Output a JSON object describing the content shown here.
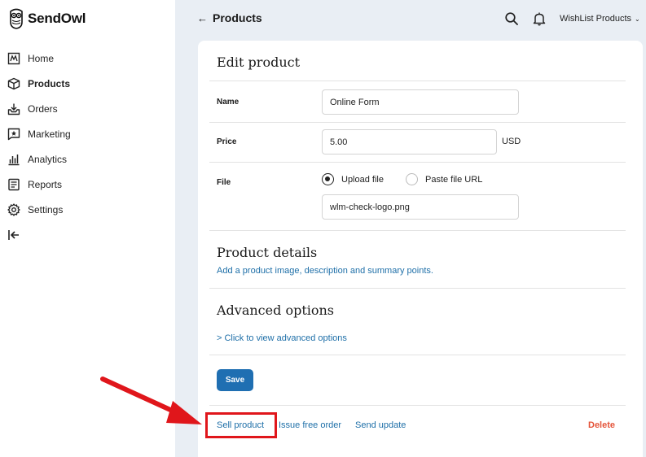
{
  "brand": {
    "name": "SendOwl"
  },
  "sidebar": {
    "items": [
      {
        "label": "Home",
        "icon": "home-chart-icon",
        "active": false
      },
      {
        "label": "Products",
        "icon": "box-icon",
        "active": true
      },
      {
        "label": "Orders",
        "icon": "download-tray-icon",
        "active": false
      },
      {
        "label": "Marketing",
        "icon": "star-message-icon",
        "active": false
      },
      {
        "label": "Analytics",
        "icon": "bar-chart-icon",
        "active": false
      },
      {
        "label": "Reports",
        "icon": "document-icon",
        "active": false
      },
      {
        "label": "Settings",
        "icon": "gear-icon",
        "active": false
      },
      {
        "label": "",
        "icon": "logout-icon",
        "active": false
      }
    ]
  },
  "header": {
    "back_arrow": "←",
    "title": "Products",
    "account": "WishList Products",
    "account_chevron": "⌄"
  },
  "edit": {
    "title": "Edit product",
    "name_label": "Name",
    "name_value": "Online Form",
    "price_label": "Price",
    "price_value": "5.00",
    "currency": "USD",
    "file_label": "File",
    "file_option_upload": "Upload file",
    "file_option_url": "Paste file URL",
    "file_selected": "upload",
    "file_value": "wlm-check-logo.png"
  },
  "details": {
    "title": "Product details",
    "link": "Add a product image, description and summary points."
  },
  "advanced": {
    "title": "Advanced options",
    "link": "> Click to view advanced options"
  },
  "actions": {
    "save": "Save",
    "sell": "Sell product",
    "issue": "Issue free order",
    "send_update": "Send update",
    "delete": "Delete"
  },
  "colors": {
    "accent": "#1f6fb2",
    "link": "#1e6fa8",
    "danger": "#e4543a",
    "annotation": "#e0161b",
    "background": "#e9eef4"
  }
}
